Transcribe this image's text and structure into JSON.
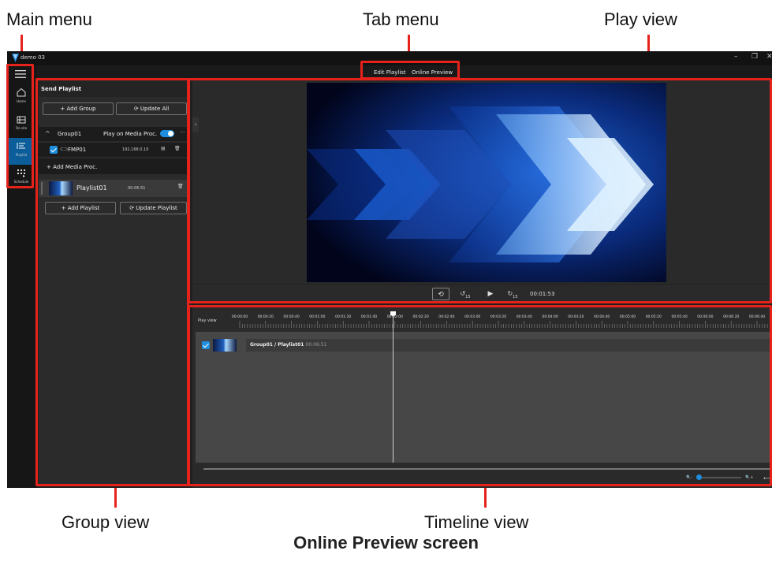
{
  "callouts": {
    "main_menu": "Main menu",
    "tab_menu": "Tab menu",
    "play_view": "Play view",
    "group_view": "Group view",
    "timeline_view": "Timeline view"
  },
  "caption": "Online Preview screen",
  "window": {
    "title": "demo 03",
    "minimize": "–",
    "restore": "❐",
    "close": "✕"
  },
  "tabs": [
    {
      "label": "Edit Playlist"
    },
    {
      "label": "Online Preview"
    }
  ],
  "main_menu": [
    {
      "label": "Home",
      "icon": "home-icon"
    },
    {
      "label": "On-site",
      "icon": "on-site-icon"
    },
    {
      "label": "Playlist",
      "icon": "playlist-icon",
      "active": true
    },
    {
      "label": "Schedule",
      "icon": "schedule-icon"
    }
  ],
  "group_view": {
    "title": "Send Playlist",
    "add_group": "+ Add Group",
    "update_all": "⟳ Update All",
    "group": {
      "name": "Group01",
      "play_on_label": "Play on Media Proc.",
      "more": "···"
    },
    "media_proc": {
      "name": "FMP01",
      "ip": "192.168.0.10"
    },
    "add_media_proc": "+ Add Media Proc.",
    "playlist": {
      "name": "Playlist01",
      "duration": "00:06:51"
    },
    "add_playlist": "+ Add Playlist",
    "update_playlist": "⟳ Update Playlist"
  },
  "controls": {
    "time": "00:01:53",
    "rewind_label": "15",
    "forward_label": "15"
  },
  "timeline": {
    "label": "Play view",
    "ticks": [
      "00:00:00",
      "00:00:20",
      "00:00:40",
      "00:01:00",
      "00:01:20",
      "00:01:40",
      "00:02:00",
      "00:02:20",
      "00:02:40",
      "00:03:00",
      "00:03:20",
      "00:03:40",
      "00:04:00",
      "00:04:20",
      "00:04:40",
      "00:05:00",
      "00:05:20",
      "00:05:40",
      "00:06:00",
      "00:06:20",
      "00:06:40"
    ],
    "clip_name": "Group01 / Playlist01",
    "clip_duration": "00:06:51",
    "zoom_out": "🔍-",
    "zoom_in": "🔍+",
    "fit": "⟷"
  },
  "colors": {
    "accent": "#1e8fe0",
    "highlight": "#e5231b",
    "active_rail": "#0b5e9a"
  }
}
